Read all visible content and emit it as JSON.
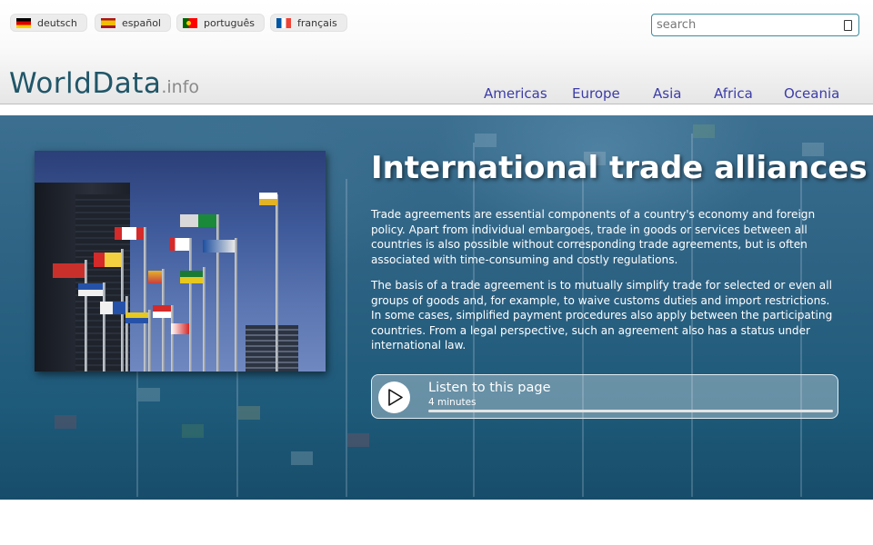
{
  "languages": [
    {
      "label": "deutsch",
      "flag": "flag-germany-icon"
    },
    {
      "label": "español",
      "flag": "flag-spain-icon"
    },
    {
      "label": "português",
      "flag": "flag-portugal-icon"
    },
    {
      "label": "français",
      "flag": "flag-france-icon"
    }
  ],
  "search": {
    "placeholder": "search",
    "value": ""
  },
  "logo": {
    "main": "WorldData",
    "suffix": ".info"
  },
  "nav": [
    "Americas",
    "Europe",
    "Asia",
    "Africa",
    "Oceania"
  ],
  "hero": {
    "title": "International trade alliances",
    "paragraphs": [
      "Trade agreements are essential components of a country's economy and foreign policy. Apart from individual embargoes, trade in goods or services between all countries is also possible without corresponding trade agreements, but is often associated with time-consuming and costly regulations.",
      "The basis of a trade agreement is to mutually simplify trade for selected or even all groups of goods and, for example, to waive customs duties and import restrictions. In some cases, simplified payment procedures also apply between the participating countries. From a legal perspective, such an agreement also has a status under international law."
    ]
  },
  "audio": {
    "title": "Listen to this page",
    "duration": "4 minutes",
    "progress": 0
  },
  "colors": {
    "logo": "#205668",
    "nav_link": "#3c3ca8",
    "hero_bg": "#1e5a7a",
    "search_border": "#3b8c9e"
  }
}
